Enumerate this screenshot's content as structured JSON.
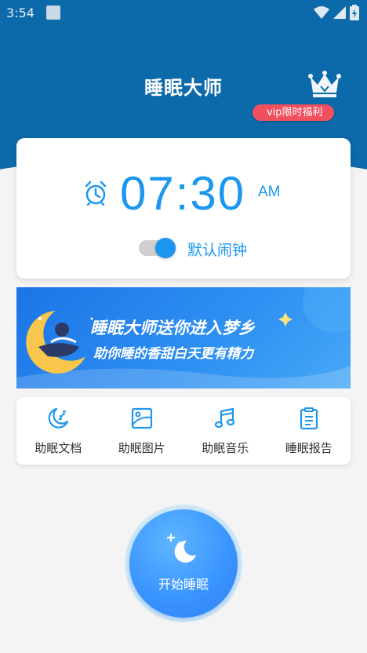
{
  "status_bar": {
    "time": "3:54"
  },
  "header": {
    "title": "睡眠大师",
    "vip_label": "vip限时福利"
  },
  "alarm": {
    "time": "07:30",
    "period": "AM",
    "toggle_on": true,
    "toggle_label": "默认闹钟"
  },
  "banner": {
    "line1": "睡眠大师送你进入梦乡",
    "line2": "助你睡的香甜白天更有精力"
  },
  "tools": [
    {
      "label": "助眠文档",
      "icon": "moon-doc-icon"
    },
    {
      "label": "助眠图片",
      "icon": "picture-icon"
    },
    {
      "label": "助眠音乐",
      "icon": "music-note-icon"
    },
    {
      "label": "睡眠报告",
      "icon": "report-icon"
    }
  ],
  "start_button": {
    "label": "开始睡眠",
    "icon": "moon-stars-icon"
  },
  "colors": {
    "header": "#0c6aaa",
    "accent": "#1c97ef",
    "vip": "#f04f5e",
    "background": "#f4f4f4"
  }
}
